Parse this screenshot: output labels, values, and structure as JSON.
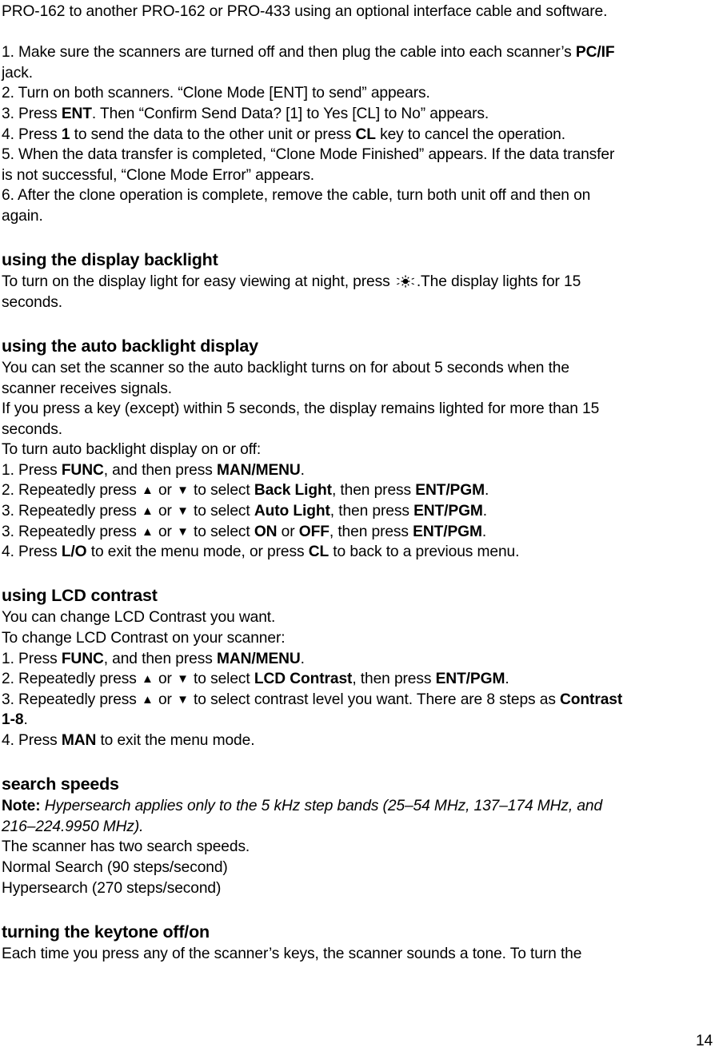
{
  "document": {
    "type": "scanner-owners-manual-page",
    "page_number": "14"
  },
  "intro": {
    "paragraph": "PRO-162 to another PRO-162 or PRO-433 using an optional interface cable and software."
  },
  "clone_steps": {
    "step1_a": "1. Make sure the scanners are turned off and then plug the cable into each scanner’s ",
    "step1_bold": "PC/IF",
    "step1_b": "jack.",
    "step2": "2. Turn on both scanners. “Clone Mode [ENT] to send” appears.",
    "step3_a": "3. Press ",
    "step3_bold": "ENT",
    "step3_b": ". Then “Confirm Send Data? [1] to Yes [CL] to No” appears.",
    "step4_a": "4. Press ",
    "step4_bold1": "1",
    "step4_b": " to send the data to the other unit or press ",
    "step4_bold2": "CL",
    "step4_c": " key to cancel the operation.",
    "step5_a": "5. When the data transfer is completed, “Clone Mode Finished” appears. If the data transfer",
    "step5_b": "is not successful, “Clone Mode Error” appears.",
    "step6_a": "6. After the clone operation is complete, remove the cable, turn both unit off and then on",
    "step6_b": "again."
  },
  "display_backlight": {
    "heading": "using the display backlight",
    "body_a": "To turn on the display light for easy viewing at night, press ",
    "icon_name": "backlight-sun-icon",
    "body_b": ".The display lights for 15",
    "body_c": "seconds."
  },
  "auto_backlight": {
    "heading": "using the auto backlight display",
    "intro_line1": "You can set the scanner so the auto backlight turns on for about 5 seconds when the",
    "intro_line2": "scanner receives signals.",
    "intro_line3": "If you press a key (except) within 5 seconds, the display remains lighted for more than 15",
    "intro_line4": "seconds.",
    "intro_line5": "To turn auto backlight display on or off:",
    "step1_a": "1. Press ",
    "step1_bold1": "FUNC",
    "step1_b": ", and then press ",
    "step1_bold2": "MAN/MENU",
    "step1_c": ".",
    "step2_a": "2. Repeatedly press ",
    "step2_b": " or ",
    "step2_c": " to select ",
    "step2_bold": "Back Light",
    "step2_d": ", then press ",
    "step2_bold2": "ENT/PGM",
    "step2_e": ".",
    "step3_a": "3. Repeatedly press ",
    "step3_b": " or ",
    "step3_c": " to select ",
    "step3_bold": "Auto Light",
    "step3_d": ", then press ",
    "step3_bold2": "ENT/PGM",
    "step3_e": ".",
    "step3b_a": "3. Repeatedly press ",
    "step3b_b": " or ",
    "step3b_c": " to select ",
    "step3b_bold": "ON",
    "step3b_d": " or ",
    "step3b_bold2": "OFF",
    "step3b_e": ", then press ",
    "step3b_bold3": "ENT/PGM",
    "step3b_f": ".",
    "step4_a": "4. Press ",
    "step4_bold1": "L/O",
    "step4_b": " to exit the menu mode, or press ",
    "step4_bold2": "CL",
    "step4_c": " to back to a previous menu.",
    "up_arrow": "▲",
    "down_arrow": "▼"
  },
  "lcd_contrast": {
    "heading": "using LCD contrast",
    "intro_line1": "You can change LCD Contrast you want.",
    "intro_line2": "To change LCD Contrast on your scanner:",
    "step1_a": "1. Press ",
    "step1_bold1": "FUNC",
    "step1_b": ", and then press ",
    "step1_bold2": "MAN/MENU",
    "step1_c": ".",
    "step2_a": "2. Repeatedly press ",
    "step2_b": " or ",
    "step2_c": " to select ",
    "step2_bold": "LCD Contrast",
    "step2_d": ", then press ",
    "step2_bold2": "ENT/PGM",
    "step2_e": ".",
    "step3_a": "3. Repeatedly press ",
    "step3_b": " or ",
    "step3_c": " to select contrast level you want. There are 8 steps as ",
    "step3_bold": "Contrast",
    "step3_bold_cont": "1-8",
    "step3_d": ".",
    "step4_a": "4. Press ",
    "step4_bold": "MAN",
    "step4_b": " to exit the menu mode.",
    "up_arrow": "▲",
    "down_arrow": "▼"
  },
  "search_speeds": {
    "heading": "search speeds",
    "note_label": "Note:",
    "note_text_line1": " Hypersearch applies only to the 5 kHz step bands (25–54 MHz, 137–174 MHz, and",
    "note_text_line2": "216–224.9950 MHz).",
    "line1": "The scanner has two search speeds.",
    "line2": "Normal Search (90 steps/second)",
    "line3": "Hypersearch (270 steps/second)"
  },
  "keytone": {
    "heading": "turning the keytone off/on",
    "line1": "Each time you press any of the scanner’s keys, the scanner sounds a tone. To turn the"
  }
}
